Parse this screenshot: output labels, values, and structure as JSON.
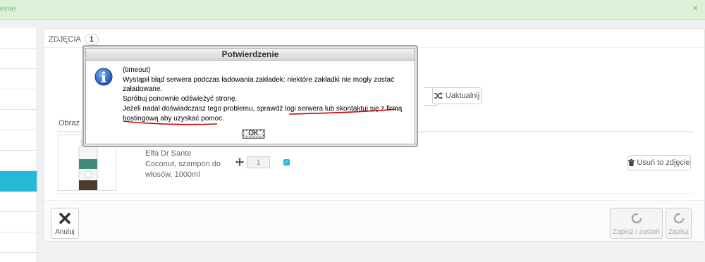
{
  "notice": {
    "text": "enie",
    "close_glyph": "×",
    "color": "#72c279"
  },
  "sidebar": {
    "items": [
      "",
      "",
      "",
      "",
      "",
      "",
      "",
      "",
      "",
      "",
      ""
    ],
    "active_index": 7
  },
  "panel": {
    "heading": "ZDJĘCIA",
    "count": "1",
    "update_button": "Uaktualnij",
    "column_image": "Obraz",
    "row": {
      "product_name": "Elfa Dr Sante Coconut, szampon do włosów, 1000ml",
      "position": "1",
      "cover_checked": true,
      "delete_button": "Usuń to zdjęcie"
    }
  },
  "footer": {
    "cancel": "Anuluj",
    "save_and_stay": "Zapisz i zostań",
    "save": "Zapisz"
  },
  "dialog": {
    "title": "Potwierdzenie",
    "lines": [
      "(timeout)",
      "Wystąpił błąd serwera podczas ładowania zakładek: niektóre zakładki nie mogły zostać załadowane.",
      "Spróbuj ponownie odświeżyć stronę.",
      "Jeżeli nadal doświadczasz tego problemu, sprawdź logi serwera lub skontaktuj się z firmą hostingową aby uzyskać pomoc."
    ],
    "ok": "OK"
  },
  "colors": {
    "accent": "#25b9d7",
    "annotation": "#cc0000"
  }
}
